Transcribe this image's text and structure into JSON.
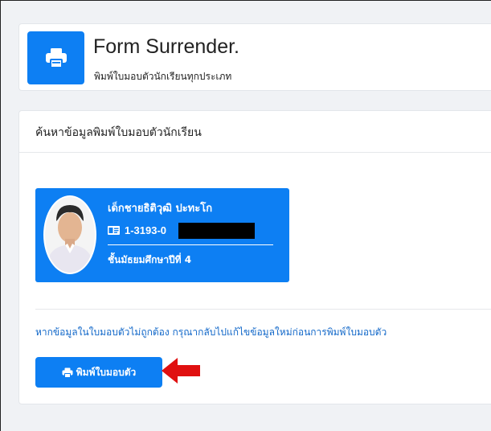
{
  "header": {
    "title": "Form Surrender.",
    "subtitle": "พิมพ์ใบมอบตัวนักเรียนทุกประเภท",
    "icon": "printer-icon"
  },
  "search_panel": {
    "title": "ค้นหาข้อมูลพิมพ์ใบมอบตัวนักเรียน"
  },
  "student": {
    "name": "เด็กชายธิติวุฒิ  ปะทะโก",
    "id_prefix": "1-3193-0",
    "grade": "ชั้นมัธยมศึกษาปีที่ 4",
    "id_icon": "id-card-icon"
  },
  "notice": "หากข้อมูลในใบมอบตัวไม่ถูกต้อง กรุณากลับไปแก้ไขข้อมูลใหม่ก่อนการพิมพ์ใบมอบตัว",
  "print_button": {
    "label": "พิมพ์ใบมอบตัว",
    "icon": "printer-icon"
  },
  "colors": {
    "accent": "#0d7ff3",
    "link": "#1268c9",
    "arrow": "#e01010"
  }
}
